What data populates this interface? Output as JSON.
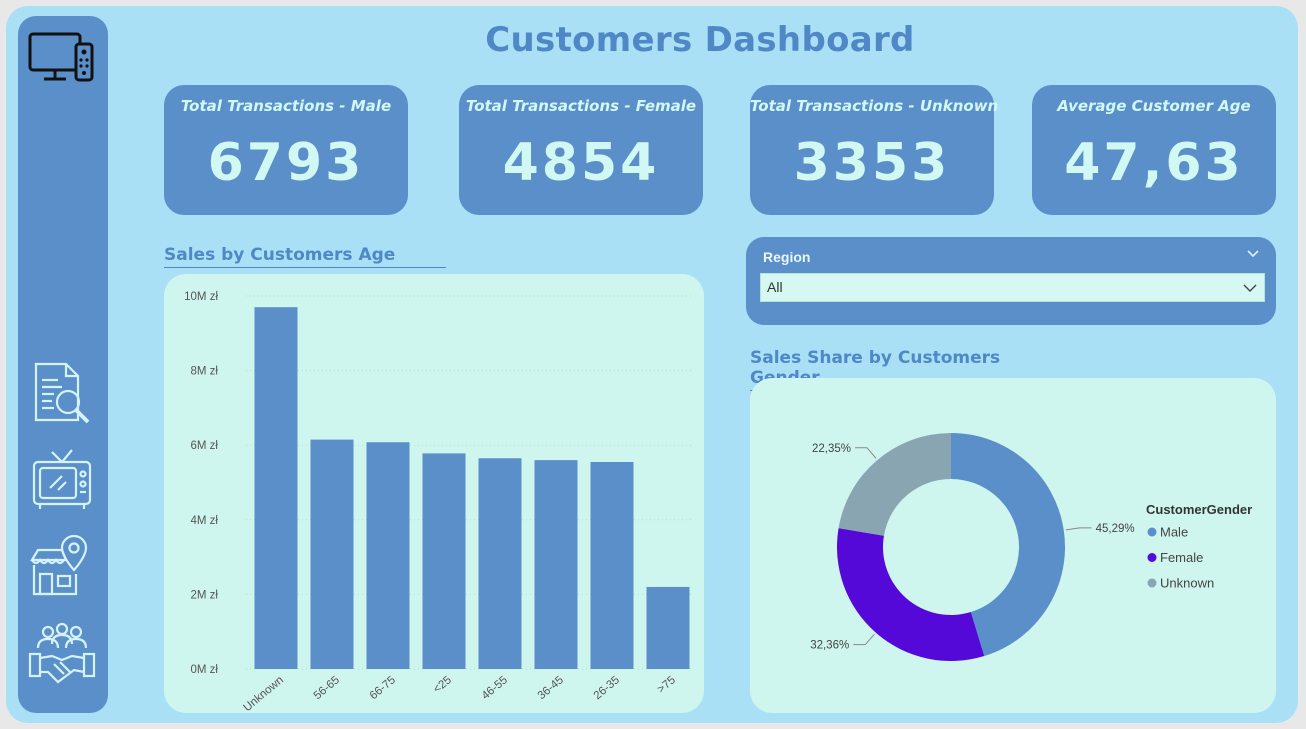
{
  "header": {
    "title": "Customers Dashboard"
  },
  "sidebar": {
    "items": [
      {
        "icon": "tv-remote-icon"
      },
      {
        "icon": "document-search-icon"
      },
      {
        "icon": "retro-tv-icon"
      },
      {
        "icon": "store-location-icon"
      },
      {
        "icon": "customers-handshake-icon"
      }
    ]
  },
  "kpis": [
    {
      "label": "Total Transactions - Male",
      "value": "6793"
    },
    {
      "label": "Total Transactions - Female",
      "value": "4854"
    },
    {
      "label": "Total Transactions - Unknown",
      "value": "3353"
    },
    {
      "label": "Average Customer Age",
      "value": "47,63"
    }
  ],
  "slicer": {
    "label": "Region",
    "value": "All"
  },
  "colors": {
    "primary": "#5a8fca",
    "female": "#5409d8",
    "unknown": "#8aa5b2",
    "panel": "#cff6ee",
    "background": "#a9e0f5"
  },
  "chart_data": [
    {
      "type": "bar",
      "title": "Sales by Customers Age",
      "categories": [
        "Unknown",
        "56-65",
        "66-75",
        "<25",
        "46-55",
        "36-45",
        "26-35",
        ">75"
      ],
      "values": [
        9700000,
        6150000,
        6080000,
        5780000,
        5650000,
        5600000,
        5550000,
        2200000
      ],
      "ylim": [
        0,
        10000000
      ],
      "yticks": [
        0,
        2000000,
        4000000,
        6000000,
        8000000,
        10000000
      ],
      "ytick_labels": [
        "0M zł",
        "2M zł",
        "4M zł",
        "6M zł",
        "8M zł",
        "10M zł"
      ],
      "grid": true
    },
    {
      "type": "pie",
      "title": "Sales Share by Customers Gender",
      "legend_title": "CustomerGender",
      "legend_position": "right",
      "labels": [
        "Male",
        "Female",
        "Unknown"
      ],
      "values": [
        45.29,
        32.36,
        22.35
      ],
      "value_labels": [
        "45,29%",
        "32,36%",
        "22,35%"
      ],
      "colors": [
        "#5a8fca",
        "#5409d8",
        "#8aa5b2"
      ]
    }
  ]
}
